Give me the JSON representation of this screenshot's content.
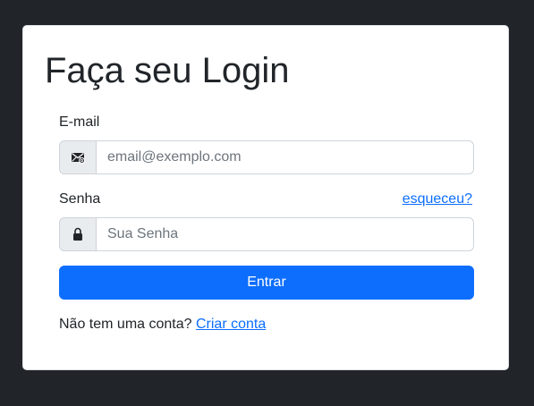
{
  "login": {
    "title": "Faça seu Login",
    "email_label": "E-mail",
    "email_placeholder": "email@exemplo.com",
    "email_icon": "envelope-icon",
    "password_label": "Senha",
    "forgot_link": "esqueceu?",
    "password_placeholder": "Sua Senha",
    "password_icon": "lock-icon",
    "submit_label": "Entrar",
    "signup_prompt": "Não tem uma conta?",
    "signup_link": "Criar conta"
  },
  "colors": {
    "background": "#212529",
    "card": "#ffffff",
    "primary": "#0d6efd",
    "addon": "#e9ecef",
    "border": "#ced4da"
  }
}
